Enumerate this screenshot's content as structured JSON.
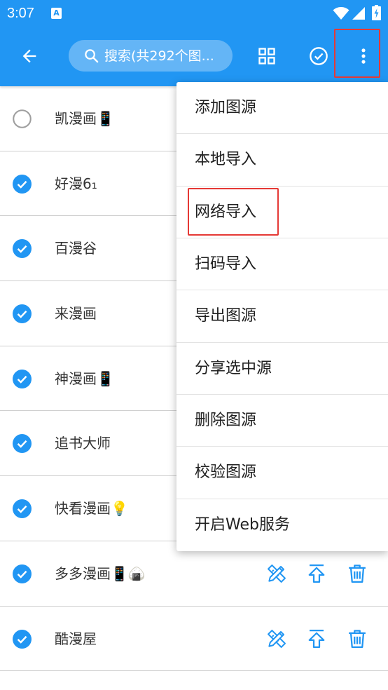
{
  "status_bar": {
    "time": "3:07",
    "notification_letter": "A",
    "icons": [
      "wifi-icon",
      "signal-icon",
      "battery-charging-icon"
    ]
  },
  "app_bar": {
    "back_icon": "arrow-back-icon",
    "search": {
      "icon": "search-icon",
      "placeholder": "搜索(共292个图..."
    },
    "actions": [
      "grid-view-icon",
      "check-circle-icon",
      "more-vert-icon"
    ]
  },
  "list": {
    "items": [
      {
        "label": "凯漫画📱",
        "checked": false
      },
      {
        "label": "好漫6₁",
        "checked": true
      },
      {
        "label": "百漫谷",
        "checked": true
      },
      {
        "label": "来漫画",
        "checked": true
      },
      {
        "label": "神漫画📱",
        "checked": true
      },
      {
        "label": "追书大师",
        "checked": true
      },
      {
        "label": "快看漫画💡",
        "checked": true
      },
      {
        "label": "多多漫画📱🍙",
        "checked": true
      },
      {
        "label": "酷漫屋",
        "checked": true
      }
    ],
    "row_actions": [
      "edit-icon",
      "upload-icon",
      "delete-icon"
    ]
  },
  "menu": {
    "items": [
      "添加图源",
      "本地导入",
      "网络导入",
      "扫码导入",
      "导出图源",
      "分享选中源",
      "删除图源",
      "校验图源",
      "开启Web服务"
    ]
  },
  "colors": {
    "primary": "#2196F3",
    "highlight": "#E53935",
    "text": "#212121",
    "unchecked": "#9E9E9E"
  }
}
